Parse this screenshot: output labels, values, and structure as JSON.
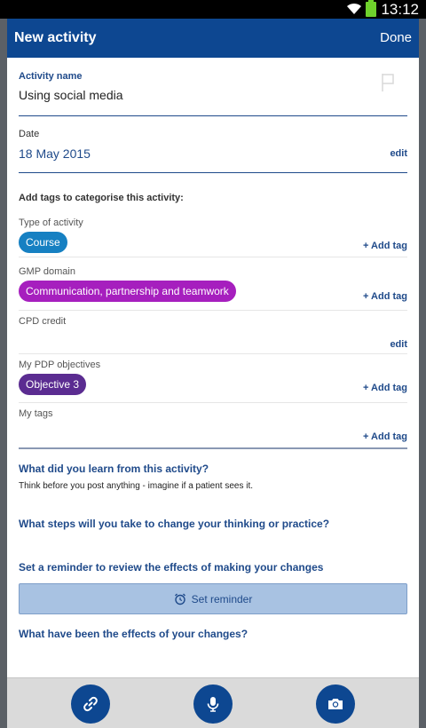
{
  "status_bar": {
    "time": "13:12"
  },
  "header": {
    "title": "New activity",
    "done_label": "Done"
  },
  "activity": {
    "label": "Activity name",
    "value": "Using social media"
  },
  "date": {
    "label": "Date",
    "value": "18 May 2015",
    "edit_label": "edit"
  },
  "tags_intro": "Add tags to categorise this activity:",
  "tag_rows": [
    {
      "label": "Type of activity",
      "pill": "Course",
      "action": "+ Add tag",
      "color": "#1680c2"
    },
    {
      "label": "GMP domain",
      "pill": "Communication, partnership and teamwork",
      "action": "+ Add tag",
      "color": "#a61fbe"
    },
    {
      "label": "CPD credit",
      "pill": "",
      "action": "edit"
    },
    {
      "label": "My PDP objectives",
      "pill": "Objective 3",
      "action": "+ Add tag",
      "color": "#5b2c91"
    },
    {
      "label": "My tags",
      "pill": "",
      "action": "+ Add tag"
    }
  ],
  "questions": {
    "learn": "What did you learn from this activity?",
    "learn_answer": "Think before you post anything - imagine if a patient sees it.",
    "steps": "What steps will you take to change your thinking or practice?",
    "reminder_prompt": "Set a reminder to review the effects of making your changes",
    "reminder_button": "Set reminder",
    "effects": "What have been the effects of your changes?"
  },
  "bottom_bar": {
    "icons": [
      "link-icon",
      "microphone-icon",
      "camera-icon"
    ]
  },
  "colors": {
    "primary": "#0d4791",
    "accent_text": "#1f4a8a"
  }
}
